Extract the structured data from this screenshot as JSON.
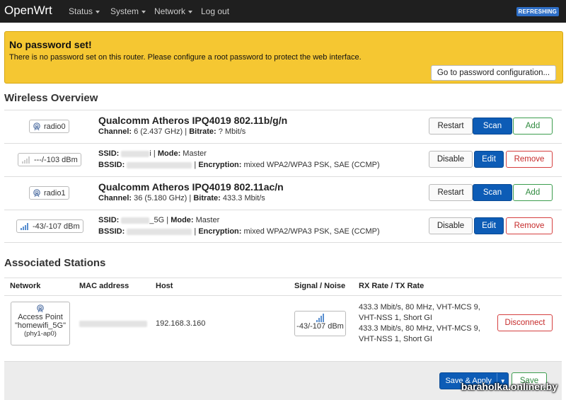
{
  "nav": {
    "brand": "OpenWrt",
    "items": [
      "Status",
      "System",
      "Network",
      "Log out"
    ],
    "badge": "REFRESHING"
  },
  "alert": {
    "title": "No password set!",
    "text": "There is no password set on this router. Please configure a root password to protect the web interface.",
    "button": "Go to password configuration..."
  },
  "wireless": {
    "heading": "Wireless Overview",
    "radios": [
      {
        "badge": "radio0",
        "title": "Qualcomm Atheros IPQ4019 802.11b/g/n",
        "channel_label": "Channel:",
        "channel": "6 (2.437 GHz)",
        "bitrate_label": "Bitrate:",
        "bitrate": "? Mbit/s",
        "buttons": [
          "Restart",
          "Scan",
          "Add"
        ],
        "network": {
          "signal": "---/-103 dBm",
          "ssid_label": "SSID:",
          "ssid_suffix": "i",
          "mode_label": "Mode:",
          "mode": "Master",
          "bssid_label": "BSSID:",
          "enc_label": "Encryption:",
          "encryption": "mixed WPA2/WPA3 PSK, SAE (CCMP)",
          "buttons": [
            "Disable",
            "Edit",
            "Remove"
          ]
        }
      },
      {
        "badge": "radio1",
        "title": "Qualcomm Atheros IPQ4019 802.11ac/n",
        "channel_label": "Channel:",
        "channel": "36 (5.180 GHz)",
        "bitrate_label": "Bitrate:",
        "bitrate": "433.3 Mbit/s",
        "buttons": [
          "Restart",
          "Scan",
          "Add"
        ],
        "network": {
          "signal": "-43/-107 dBm",
          "ssid_label": "SSID:",
          "ssid_suffix": "_5G",
          "mode_label": "Mode:",
          "mode": "Master",
          "bssid_label": "BSSID:",
          "enc_label": "Encryption:",
          "encryption": "mixed WPA2/WPA3 PSK, SAE (CCMP)",
          "buttons": [
            "Disable",
            "Edit",
            "Remove"
          ]
        }
      }
    ]
  },
  "stations": {
    "heading": "Associated Stations",
    "columns": [
      "Network",
      "MAC address",
      "Host",
      "Signal / Noise",
      "RX Rate / TX Rate"
    ],
    "rows": [
      {
        "network_line1": "Access Point",
        "network_line2": "\"homewifi_5G\"",
        "network_line3": "(phy1-ap0)",
        "host": "192.168.3.160",
        "signal": "-43/-107 dBm",
        "rx_rate": "433.3 Mbit/s, 80 MHz, VHT-MCS 9, VHT-NSS 1, Short GI",
        "tx_rate": "433.3 Mbit/s, 80 MHz, VHT-MCS 9, VHT-NSS 1, Short GI",
        "button": "Disconnect"
      }
    ]
  },
  "footer": {
    "save_apply": "Save & Apply",
    "save": "Save",
    "watermark": "baraholka.onliner.by"
  },
  "colors": {
    "navbar": "#1f1f1f",
    "alert": "#f5c732",
    "primary": "#0d5cb6",
    "positive": "#3c9d4e",
    "negative": "#d54040"
  }
}
